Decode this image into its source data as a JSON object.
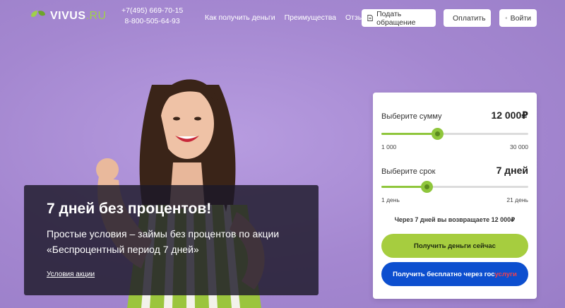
{
  "header": {
    "logo": {
      "name": "VIVUS",
      "suffix": ".RU"
    },
    "phones": [
      "+7(495) 669-70-15",
      "8-800-505-64-93"
    ],
    "nav": [
      {
        "label": "Как получить деньги"
      },
      {
        "label": "Преимущества"
      },
      {
        "label": "Отзывы"
      }
    ],
    "buttons": {
      "appeal": "Подать обращение",
      "pay": "Оплатить",
      "login": "Войти"
    }
  },
  "promo": {
    "title": "7 дней без процентов!",
    "text": "Простые условия – займы без процентов по акции «Беспроцентный период 7 дней»",
    "link": "Условия акции"
  },
  "calculator": {
    "amount": {
      "label": "Выберите сумму",
      "value": "12 000₽",
      "min_label": "1 000",
      "max_label": "30 000",
      "fraction": 0.38
    },
    "term": {
      "label": "Выберите срок",
      "value": "7 дней",
      "min_label": "1 день",
      "max_label": "21 день",
      "fraction": 0.31
    },
    "summary": "Через 7 дней вы возвращаете 12 000₽",
    "primary_button": "Получить деньги сейчас",
    "gos_button": {
      "prefix": "Получить бесплатно через гос",
      "accent": "услуги"
    }
  },
  "colors": {
    "background": "#a98bd3",
    "accent_green": "#8fc63c",
    "button_green": "#a6cd3f",
    "button_blue": "#0d4fcf",
    "gos_red": "#f0404e"
  }
}
